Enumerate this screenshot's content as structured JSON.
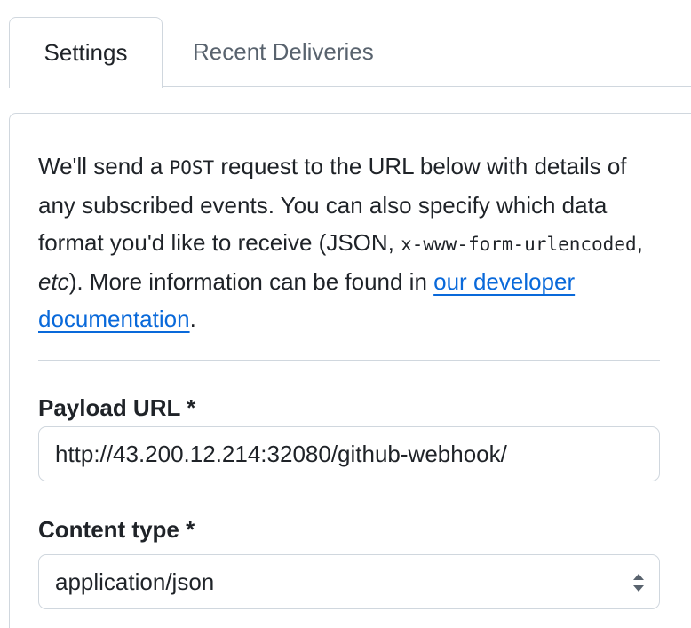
{
  "tabs": [
    {
      "label": "Settings",
      "active": true
    },
    {
      "label": "Recent Deliveries",
      "active": false
    }
  ],
  "intro": {
    "part1": "We'll send a ",
    "code1": "POST",
    "part2": " request to the URL below with details of any subscribed events. You can also specify which data format you'd like to receive (JSON, ",
    "code2": "x-www-form-urlencoded",
    "part3": ", ",
    "em": "etc",
    "part4": "). More information can be found in ",
    "link": "our developer documentation",
    "part5": "."
  },
  "payload_url": {
    "label": "Payload URL *",
    "value": "http://43.200.12.214:32080/github-webhook/"
  },
  "content_type": {
    "label": "Content type *",
    "selected": "application/json",
    "icon": "select-arrows-icon"
  },
  "colors": {
    "link": "#0969da",
    "border": "#d0d7de",
    "text": "#1f2328",
    "muted": "#59636e"
  }
}
